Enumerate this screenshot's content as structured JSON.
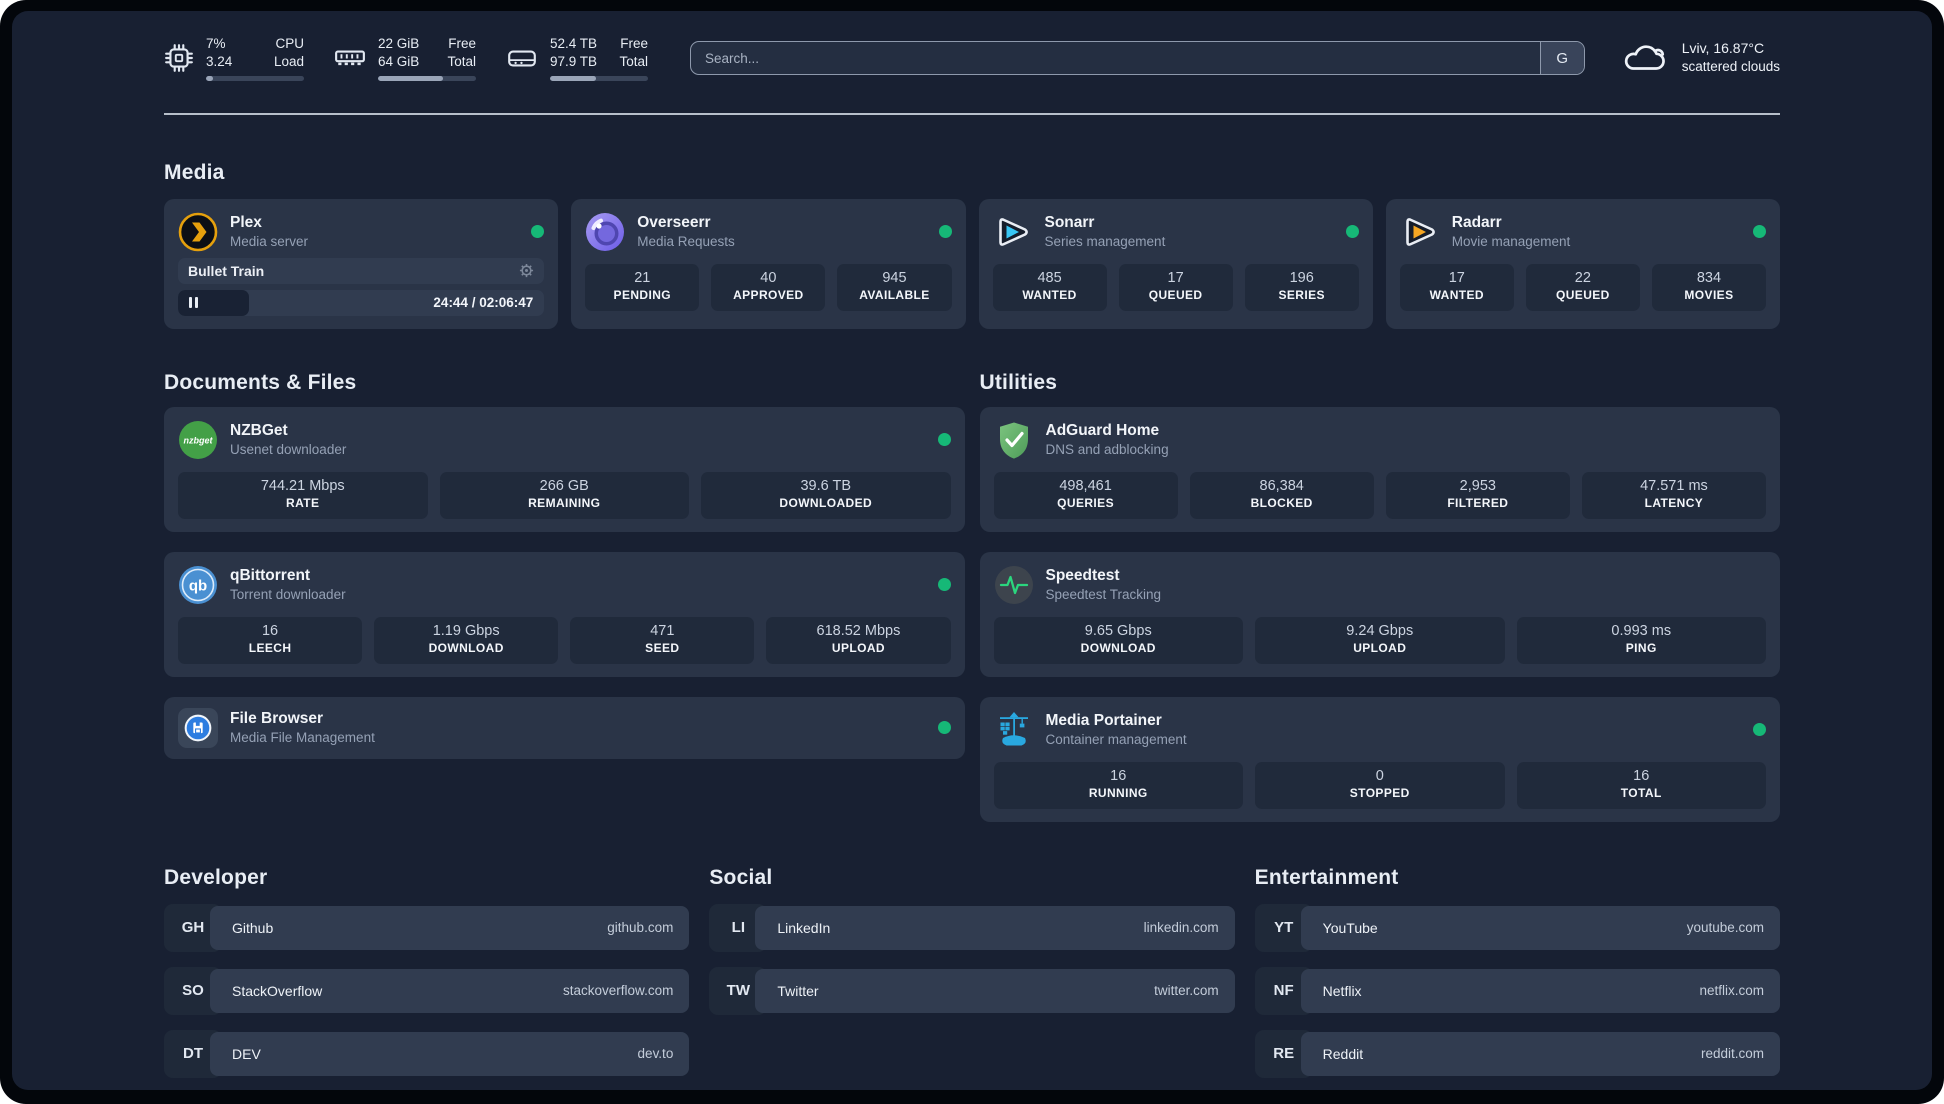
{
  "header": {
    "metrics": [
      {
        "name": "cpu",
        "value_top": "7%",
        "value_bottom": "3.24",
        "label_top": "CPU",
        "label_bottom": "Load",
        "progress": 7
      },
      {
        "name": "memory",
        "value_top": "22 GiB",
        "value_bottom": "64 GiB",
        "label_top": "Free",
        "label_bottom": "Total",
        "progress": 66
      },
      {
        "name": "storage",
        "value_top": "52.4 TB",
        "value_bottom": "97.9 TB",
        "label_top": "Free",
        "label_bottom": "Total",
        "progress": 47
      }
    ],
    "search": {
      "placeholder": "Search...",
      "engine": "G"
    },
    "weather": {
      "location_temp": "Lviv, 16.87°C",
      "condition": "scattered clouds"
    }
  },
  "media": {
    "title": "Media",
    "plex": {
      "title": "Plex",
      "subtitle": "Media server",
      "now_playing": "Bullet Train",
      "time": "24:44 / 02:06:47",
      "progress": 19.5
    },
    "overseerr": {
      "title": "Overseerr",
      "subtitle": "Media Requests",
      "stats": [
        {
          "value": "21",
          "label": "PENDING"
        },
        {
          "value": "40",
          "label": "APPROVED"
        },
        {
          "value": "945",
          "label": "AVAILABLE"
        }
      ]
    },
    "sonarr": {
      "title": "Sonarr",
      "subtitle": "Series management",
      "stats": [
        {
          "value": "485",
          "label": "WANTED"
        },
        {
          "value": "17",
          "label": "QUEUED"
        },
        {
          "value": "196",
          "label": "SERIES"
        }
      ]
    },
    "radarr": {
      "title": "Radarr",
      "subtitle": "Movie management",
      "stats": [
        {
          "value": "17",
          "label": "WANTED"
        },
        {
          "value": "22",
          "label": "QUEUED"
        },
        {
          "value": "834",
          "label": "MOVIES"
        }
      ]
    }
  },
  "documents": {
    "title": "Documents & Files",
    "nzbget": {
      "title": "NZBGet",
      "subtitle": "Usenet downloader",
      "stats": [
        {
          "value": "744.21 Mbps",
          "label": "RATE"
        },
        {
          "value": "266 GB",
          "label": "REMAINING"
        },
        {
          "value": "39.6 TB",
          "label": "DOWNLOADED"
        }
      ]
    },
    "qbittorrent": {
      "title": "qBittorrent",
      "subtitle": "Torrent downloader",
      "stats": [
        {
          "value": "16",
          "label": "LEECH"
        },
        {
          "value": "1.19 Gbps",
          "label": "DOWNLOAD"
        },
        {
          "value": "471",
          "label": "SEED"
        },
        {
          "value": "618.52 Mbps",
          "label": "UPLOAD"
        }
      ]
    },
    "filebrowser": {
      "title": "File Browser",
      "subtitle": "Media File Management"
    }
  },
  "utilities": {
    "title": "Utilities",
    "adguard": {
      "title": "AdGuard Home",
      "subtitle": "DNS and adblocking",
      "stats": [
        {
          "value": "498,461",
          "label": "QUERIES"
        },
        {
          "value": "86,384",
          "label": "BLOCKED"
        },
        {
          "value": "2,953",
          "label": "FILTERED"
        },
        {
          "value": "47.571 ms",
          "label": "LATENCY"
        }
      ]
    },
    "speedtest": {
      "title": "Speedtest",
      "subtitle": "Speedtest Tracking",
      "stats": [
        {
          "value": "9.65 Gbps",
          "label": "DOWNLOAD"
        },
        {
          "value": "9.24 Gbps",
          "label": "UPLOAD"
        },
        {
          "value": "0.993 ms",
          "label": "PING"
        }
      ]
    },
    "portainer": {
      "title": "Media Portainer",
      "subtitle": "Container management",
      "stats": [
        {
          "value": "16",
          "label": "RUNNING"
        },
        {
          "value": "0",
          "label": "STOPPED"
        },
        {
          "value": "16",
          "label": "TOTAL"
        }
      ]
    }
  },
  "developer": {
    "title": "Developer",
    "links": [
      {
        "abbr": "GH",
        "name": "Github",
        "url": "github.com"
      },
      {
        "abbr": "SO",
        "name": "StackOverflow",
        "url": "stackoverflow.com"
      },
      {
        "abbr": "DT",
        "name": "DEV",
        "url": "dev.to"
      }
    ]
  },
  "social": {
    "title": "Social",
    "links": [
      {
        "abbr": "LI",
        "name": "LinkedIn",
        "url": "linkedin.com"
      },
      {
        "abbr": "TW",
        "name": "Twitter",
        "url": "twitter.com"
      }
    ]
  },
  "entertainment": {
    "title": "Entertainment",
    "links": [
      {
        "abbr": "YT",
        "name": "YouTube",
        "url": "youtube.com"
      },
      {
        "abbr": "NF",
        "name": "Netflix",
        "url": "netflix.com"
      },
      {
        "abbr": "RE",
        "name": "Reddit",
        "url": "reddit.com"
      }
    ]
  },
  "icons": {
    "header": [
      "cpu-icon",
      "memory-icon",
      "storage-icon",
      "cloud-icon"
    ],
    "apps": [
      "plex-icon",
      "overseerr-icon",
      "sonarr-icon",
      "radarr-icon",
      "nzbget-icon",
      "qbittorrent-icon",
      "filebrowser-icon",
      "adguard-icon",
      "speedtest-icon",
      "portainer-icon"
    ],
    "misc": [
      "gear-icon",
      "pause-icon",
      "status-dot"
    ]
  },
  "colors": {
    "status_online": "#16b877",
    "plex_accent": "#e5a00d",
    "background": "#182032",
    "card": "#2a3447"
  }
}
